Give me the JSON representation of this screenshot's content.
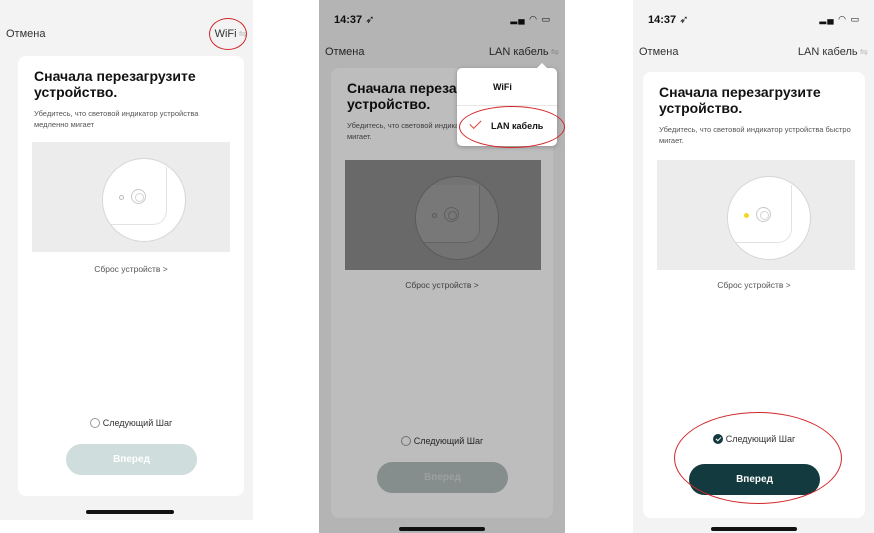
{
  "colors": {
    "primary_dark": "#133a3f",
    "primary_disabled": "#cfdddc",
    "annotation_red": "#d3272a",
    "led_yellow": "#f5d623"
  },
  "screens": [
    {
      "status": {
        "time": "",
        "signal": ""
      },
      "nav": {
        "cancel": "Отмена",
        "mode": "WiFi",
        "mode_icon": "swap-icon"
      },
      "title": "Сначала перезагрузите устройство.",
      "subtitle": "Убедитесь, что световой индикатор устройства медленно мигает",
      "reset_link": "Сброс устройств >",
      "next_step": {
        "label": "Следующий Шаг",
        "checked": false
      },
      "button": {
        "label": "Вперед",
        "enabled": false
      }
    },
    {
      "status": {
        "time": "14:37 ➶",
        "signal": "▂▄ ◠ ▭"
      },
      "nav": {
        "cancel": "Отмена",
        "mode": "LAN кабель",
        "mode_icon": "swap-icon"
      },
      "title": "Сначала перезагрузите устройство.",
      "subtitle": "Убедитесь, что световой индикатор устройства быстро мигает.",
      "reset_link": "Сброс устройств >",
      "next_step": {
        "label": "Следующий Шаг",
        "checked": false
      },
      "button": {
        "label": "Вперед",
        "enabled": false
      },
      "dropdown": {
        "options": [
          "WiFi",
          "LAN кабель"
        ],
        "selected": "LAN кабель"
      }
    },
    {
      "status": {
        "time": "14:37 ➶",
        "signal": "▂▄ ◠ ▭"
      },
      "nav": {
        "cancel": "Отмена",
        "mode": "LAN кабель",
        "mode_icon": "swap-icon"
      },
      "title": "Сначала перезагрузите устройство.",
      "subtitle": "Убедитесь, что световой индикатор устройства быстро мигает.",
      "reset_link": "Сброс устройств >",
      "next_step": {
        "label": "Следующий Шаг",
        "checked": true
      },
      "button": {
        "label": "Вперед",
        "enabled": true
      }
    }
  ]
}
